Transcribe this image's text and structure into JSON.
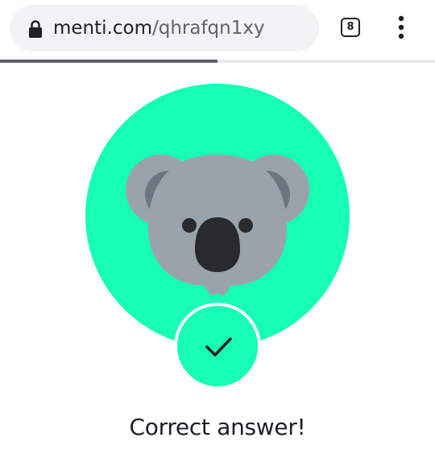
{
  "browser": {
    "url_domain": "menti.com",
    "url_path": "/qhrafqn1xy",
    "tab_count": "8",
    "page_load_progress_fraction": 0.5
  },
  "result": {
    "message": "Correct answer!"
  },
  "colors": {
    "accent_green": "#16ffb4",
    "koala_gray": "#9aa3ab",
    "koala_ear_inner": "#6b7780",
    "koala_nose": "#2a2a2e",
    "text_dark": "#1e1e24"
  },
  "icons": {
    "lock": "lock-icon",
    "tabs": "tab-switcher-icon",
    "menu": "more-vert-icon",
    "avatar": "koala-icon",
    "check": "checkmark-icon"
  }
}
